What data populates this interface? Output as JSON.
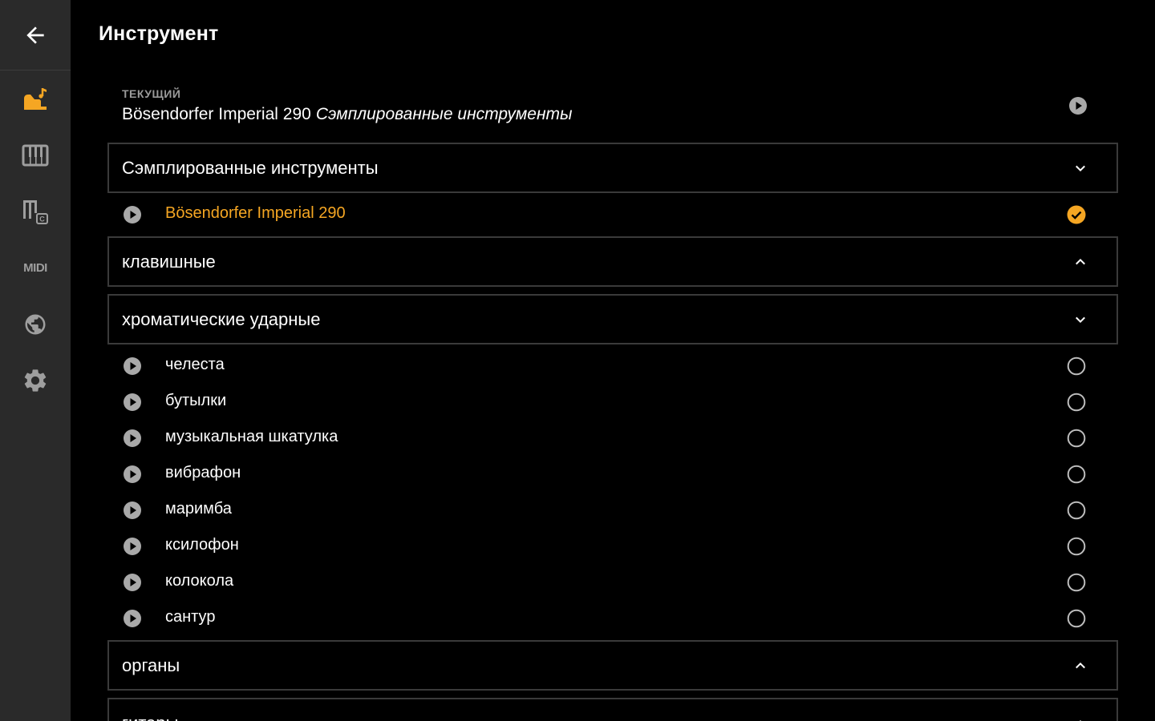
{
  "header": {
    "title": "Инструмент"
  },
  "sidebar": {
    "items": [
      {
        "icon": "arrow-left-icon"
      },
      {
        "icon": "instrument-icon",
        "active": true
      },
      {
        "icon": "keyboard-icon"
      },
      {
        "icon": "chord-icon"
      },
      {
        "icon": "midi-icon",
        "label": "MIDI"
      },
      {
        "icon": "globe-icon"
      },
      {
        "icon": "gear-icon"
      }
    ]
  },
  "current": {
    "label": "ТЕКУЩИЙ",
    "instrument": "Bösendorfer Imperial 290",
    "category": "Сэмплированные инструменты"
  },
  "categories": [
    {
      "label": "Сэмплированные инструменты",
      "expanded": true,
      "items": [
        {
          "name": "Bösendorfer Imperial 290",
          "selected": true
        }
      ]
    },
    {
      "label": "клавишные",
      "expanded": false,
      "items": []
    },
    {
      "label": "хроматические ударные",
      "expanded": true,
      "items": [
        {
          "name": "челеста",
          "selected": false
        },
        {
          "name": "бутылки",
          "selected": false
        },
        {
          "name": "музыкальная шкатулка",
          "selected": false
        },
        {
          "name": "вибрафон",
          "selected": false
        },
        {
          "name": "маримба",
          "selected": false
        },
        {
          "name": "ксилофон",
          "selected": false
        },
        {
          "name": "колокола",
          "selected": false
        },
        {
          "name": "сантур",
          "selected": false
        }
      ]
    },
    {
      "label": "органы",
      "expanded": false,
      "items": []
    },
    {
      "label": "гитары",
      "expanded": false,
      "items": []
    }
  ],
  "colors": {
    "accent": "#f5a623",
    "sidebar_bg": "#2a2a2a",
    "background": "#000000",
    "border": "#3a3a3a",
    "icon_gray": "#9e9e9e"
  }
}
